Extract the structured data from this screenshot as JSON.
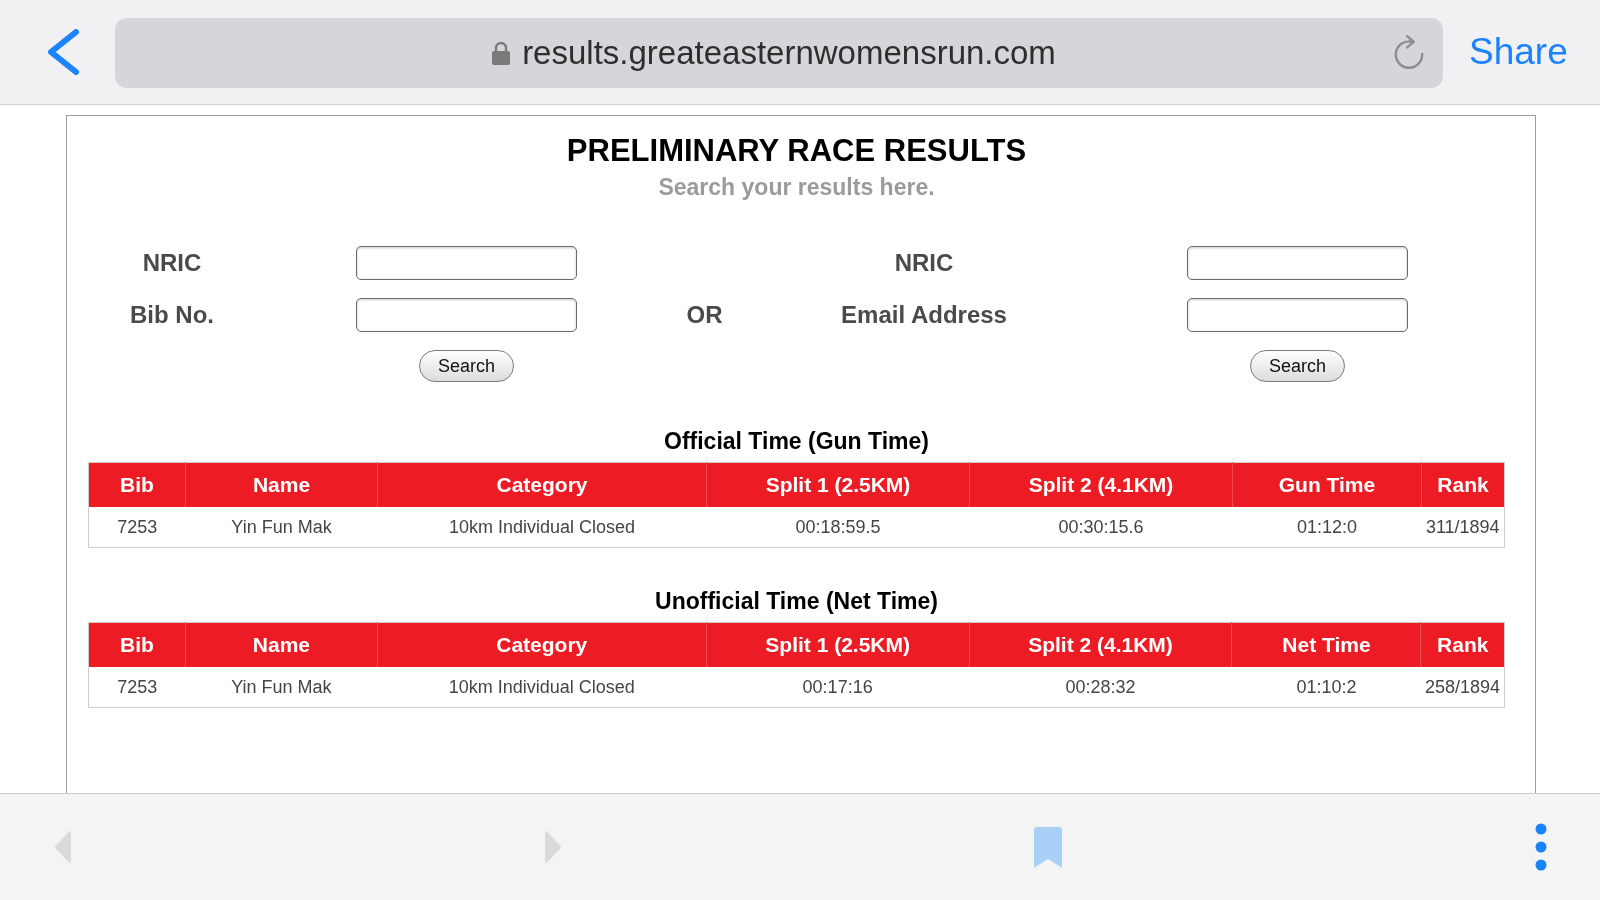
{
  "browser": {
    "url": "results.greateasternwomensrun.com",
    "share": "Share"
  },
  "page": {
    "title": "PRELIMINARY RACE RESULTS",
    "subtitle": "Search your results here.",
    "search_forms": [
      {
        "fields": [
          {
            "label": "NRIC"
          },
          {
            "label": "Bib No."
          }
        ],
        "button": "Search"
      },
      {
        "fields": [
          {
            "label": "NRIC"
          },
          {
            "label": "Email Address"
          }
        ],
        "button": "Search"
      }
    ],
    "separator": "OR",
    "results": [
      {
        "heading": "Official Time (Gun Time)",
        "columns": [
          "Bib",
          "Name",
          "Category",
          "Split 1 (2.5KM)",
          "Split 2 (4.1KM)",
          "Gun Time",
          "Rank"
        ],
        "rows": [
          [
            "7253",
            "Yin Fun Mak",
            "10km Individual Closed",
            "00:18:59.5",
            "00:30:15.6",
            "01:12:0",
            "311/1894"
          ]
        ]
      },
      {
        "heading": "Unofficial Time (Net Time)",
        "columns": [
          "Bib",
          "Name",
          "Category",
          "Split 1 (2.5KM)",
          "Split 2 (4.1KM)",
          "Net Time",
          "Rank"
        ],
        "rows": [
          [
            "7253",
            "Yin Fun Mak",
            "10km Individual Closed",
            "00:17:16",
            "00:28:32",
            "01:10:2",
            "258/1894"
          ]
        ]
      }
    ]
  },
  "bottom_toolbar": [
    {
      "kind": "back",
      "disabled": true
    },
    {
      "kind": "forward",
      "disabled": true
    },
    {
      "kind": "bookmark",
      "disabled": false
    },
    {
      "kind": "menu",
      "disabled": false
    }
  ]
}
